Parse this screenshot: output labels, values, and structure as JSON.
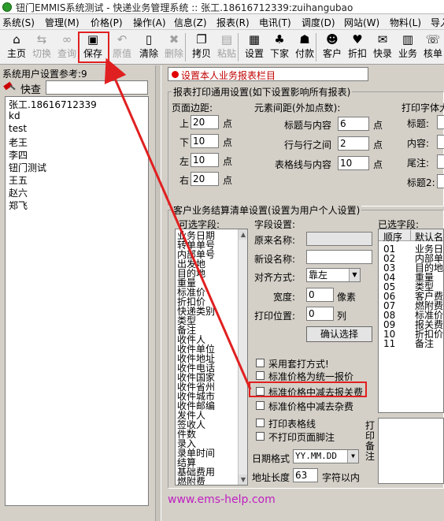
{
  "title_bar": {
    "text": "钮门EMMIS系统测试 - 快递业务管理系统 :: 张工.18616712339:zuihangubao"
  },
  "menu": [
    "系统(S)",
    "管理(M)",
    "价格(P)",
    "操作(A)",
    "信息(Z)",
    "报表(R)",
    "电讯(T)",
    "调度(D)",
    "网站(W)",
    "物料(L)",
    "导入"
  ],
  "toolbar": [
    {
      "label": "主页",
      "icon": "home-icon",
      "glyph": "⌂",
      "disabled": false
    },
    {
      "label": "切换",
      "icon": "switch-icon",
      "glyph": "⇆",
      "disabled": true
    },
    {
      "label": "查询",
      "icon": "binoculars-icon",
      "glyph": "∞",
      "disabled": true
    },
    {
      "label": "保存",
      "icon": "save-icon",
      "glyph": "▣",
      "disabled": false
    },
    {
      "label": "原值",
      "icon": "restore-icon",
      "glyph": "↶",
      "disabled": true
    },
    {
      "label": "清除",
      "icon": "clear-icon",
      "glyph": "▯",
      "disabled": false
    },
    {
      "label": "删除",
      "icon": "delete-icon",
      "glyph": "✖",
      "disabled": true
    },
    {
      "label": "拷贝",
      "icon": "copy-icon",
      "glyph": "❐",
      "disabled": false
    },
    {
      "label": "粘贴",
      "icon": "paste-icon",
      "glyph": "▤",
      "disabled": true
    },
    {
      "label": "设置",
      "icon": "settings-icon",
      "glyph": "▦",
      "disabled": false
    },
    {
      "label": "下家",
      "icon": "downstream-icon",
      "glyph": "♣",
      "disabled": false
    },
    {
      "label": "付款",
      "icon": "payment-icon",
      "glyph": "☗",
      "disabled": false
    },
    {
      "label": "客户",
      "icon": "customer-icon",
      "glyph": "☻",
      "disabled": false
    },
    {
      "label": "折扣",
      "icon": "discount-icon",
      "glyph": "♥",
      "disabled": false
    },
    {
      "label": "快录",
      "icon": "quick-entry-icon",
      "glyph": "✉",
      "disabled": false
    },
    {
      "label": "业务",
      "icon": "business-icon",
      "glyph": "▥",
      "disabled": false
    },
    {
      "label": "核单",
      "icon": "verify-icon",
      "glyph": "☏",
      "disabled": false
    }
  ],
  "left_panel": {
    "title": "系统用户设置参考:9",
    "search_label": "快查",
    "users": [
      "张工.18616712339",
      "kd",
      "test",
      "老王",
      "李四",
      "钮门测试",
      "王五",
      "赵六",
      "郑飞"
    ]
  },
  "status_label": "设置本人业务报表栏目",
  "print_settings": {
    "group_title": "报表打印通用设置(如下设置影响所有报表)",
    "margin_title": "页面边距:",
    "margins": [
      {
        "label": "上",
        "value": "20",
        "unit": "点"
      },
      {
        "label": "下",
        "value": "10",
        "unit": "点"
      },
      {
        "label": "左",
        "value": "10",
        "unit": "点"
      },
      {
        "label": "右",
        "value": "20",
        "unit": "点"
      }
    ],
    "spacing_title": "元素间距(外加点数):",
    "spacing": [
      {
        "label": "标题与内容",
        "value": "6",
        "unit": "点"
      },
      {
        "label": "行与行之间",
        "value": "2",
        "unit": "点"
      },
      {
        "label": "表格线与内容",
        "value": "10",
        "unit": "点"
      }
    ],
    "font_title": "打印字体大",
    "fonts": [
      "标题:",
      "内容:",
      "尾注:",
      "标题2:"
    ]
  },
  "customer_settings": {
    "group_title": "客户业务结算清单设置(设置为用户个人设置)",
    "available_title": "可选字段:",
    "available_fields": [
      "业务日期",
      "转单单号",
      "内部单号",
      "出发地",
      "目的地",
      "重量",
      "标准价",
      "折扣价",
      "快递类别",
      "类型",
      "备注",
      "收件人",
      "收件单位",
      "收件地址",
      "收件电话",
      "收件国家",
      "收件省州",
      "收件城市",
      "收件邮编",
      "发件人",
      "签收人",
      "件数",
      "录入",
      "录单时间",
      "结算",
      "基础费用",
      "燃附费"
    ],
    "field_settings_title": "字段设置:",
    "orig_name_label": "原来名称:",
    "new_name_label": "新设名称:",
    "align_label": "对齐方式:",
    "align_value": "靠左",
    "width_label": "宽度:",
    "width_value": "0",
    "width_unit": "像素",
    "print_pos_label": "打印位置:",
    "print_pos_value": "0",
    "print_pos_unit": "列",
    "confirm_button": "确认选择",
    "checkboxes": [
      "采用套打方式!",
      "标准价格为统一报价",
      "标准价格中减去报关费",
      "标准价格中减去杂费",
      "打印表格线",
      "不打印页面脚注"
    ],
    "date_format_label": "日期格式",
    "date_format_value": "YY.MM.DD",
    "address_len_label": "地址长度",
    "address_len_value": "63",
    "address_len_unit": "字符以内",
    "selected_title": "已选字段:",
    "selected_header": [
      "顺序",
      "默认名"
    ],
    "selected_rows": [
      [
        "01",
        "业务日"
      ],
      [
        "02",
        "内部单"
      ],
      [
        "03",
        "目的地"
      ],
      [
        "04",
        "重量"
      ],
      [
        "05",
        "类型"
      ],
      [
        "06",
        "客户费"
      ],
      [
        "07",
        "燃附费"
      ],
      [
        "08",
        "标准价"
      ],
      [
        "09",
        "报关费"
      ],
      [
        "10",
        "折扣价"
      ],
      [
        "11",
        "备注"
      ]
    ],
    "print_note_label": "打印备注"
  },
  "watermark": "www.ems-help.com",
  "colors": {
    "annotation_red": "#e02020",
    "status_red": "#c00000",
    "watermark": "#c020c0"
  }
}
